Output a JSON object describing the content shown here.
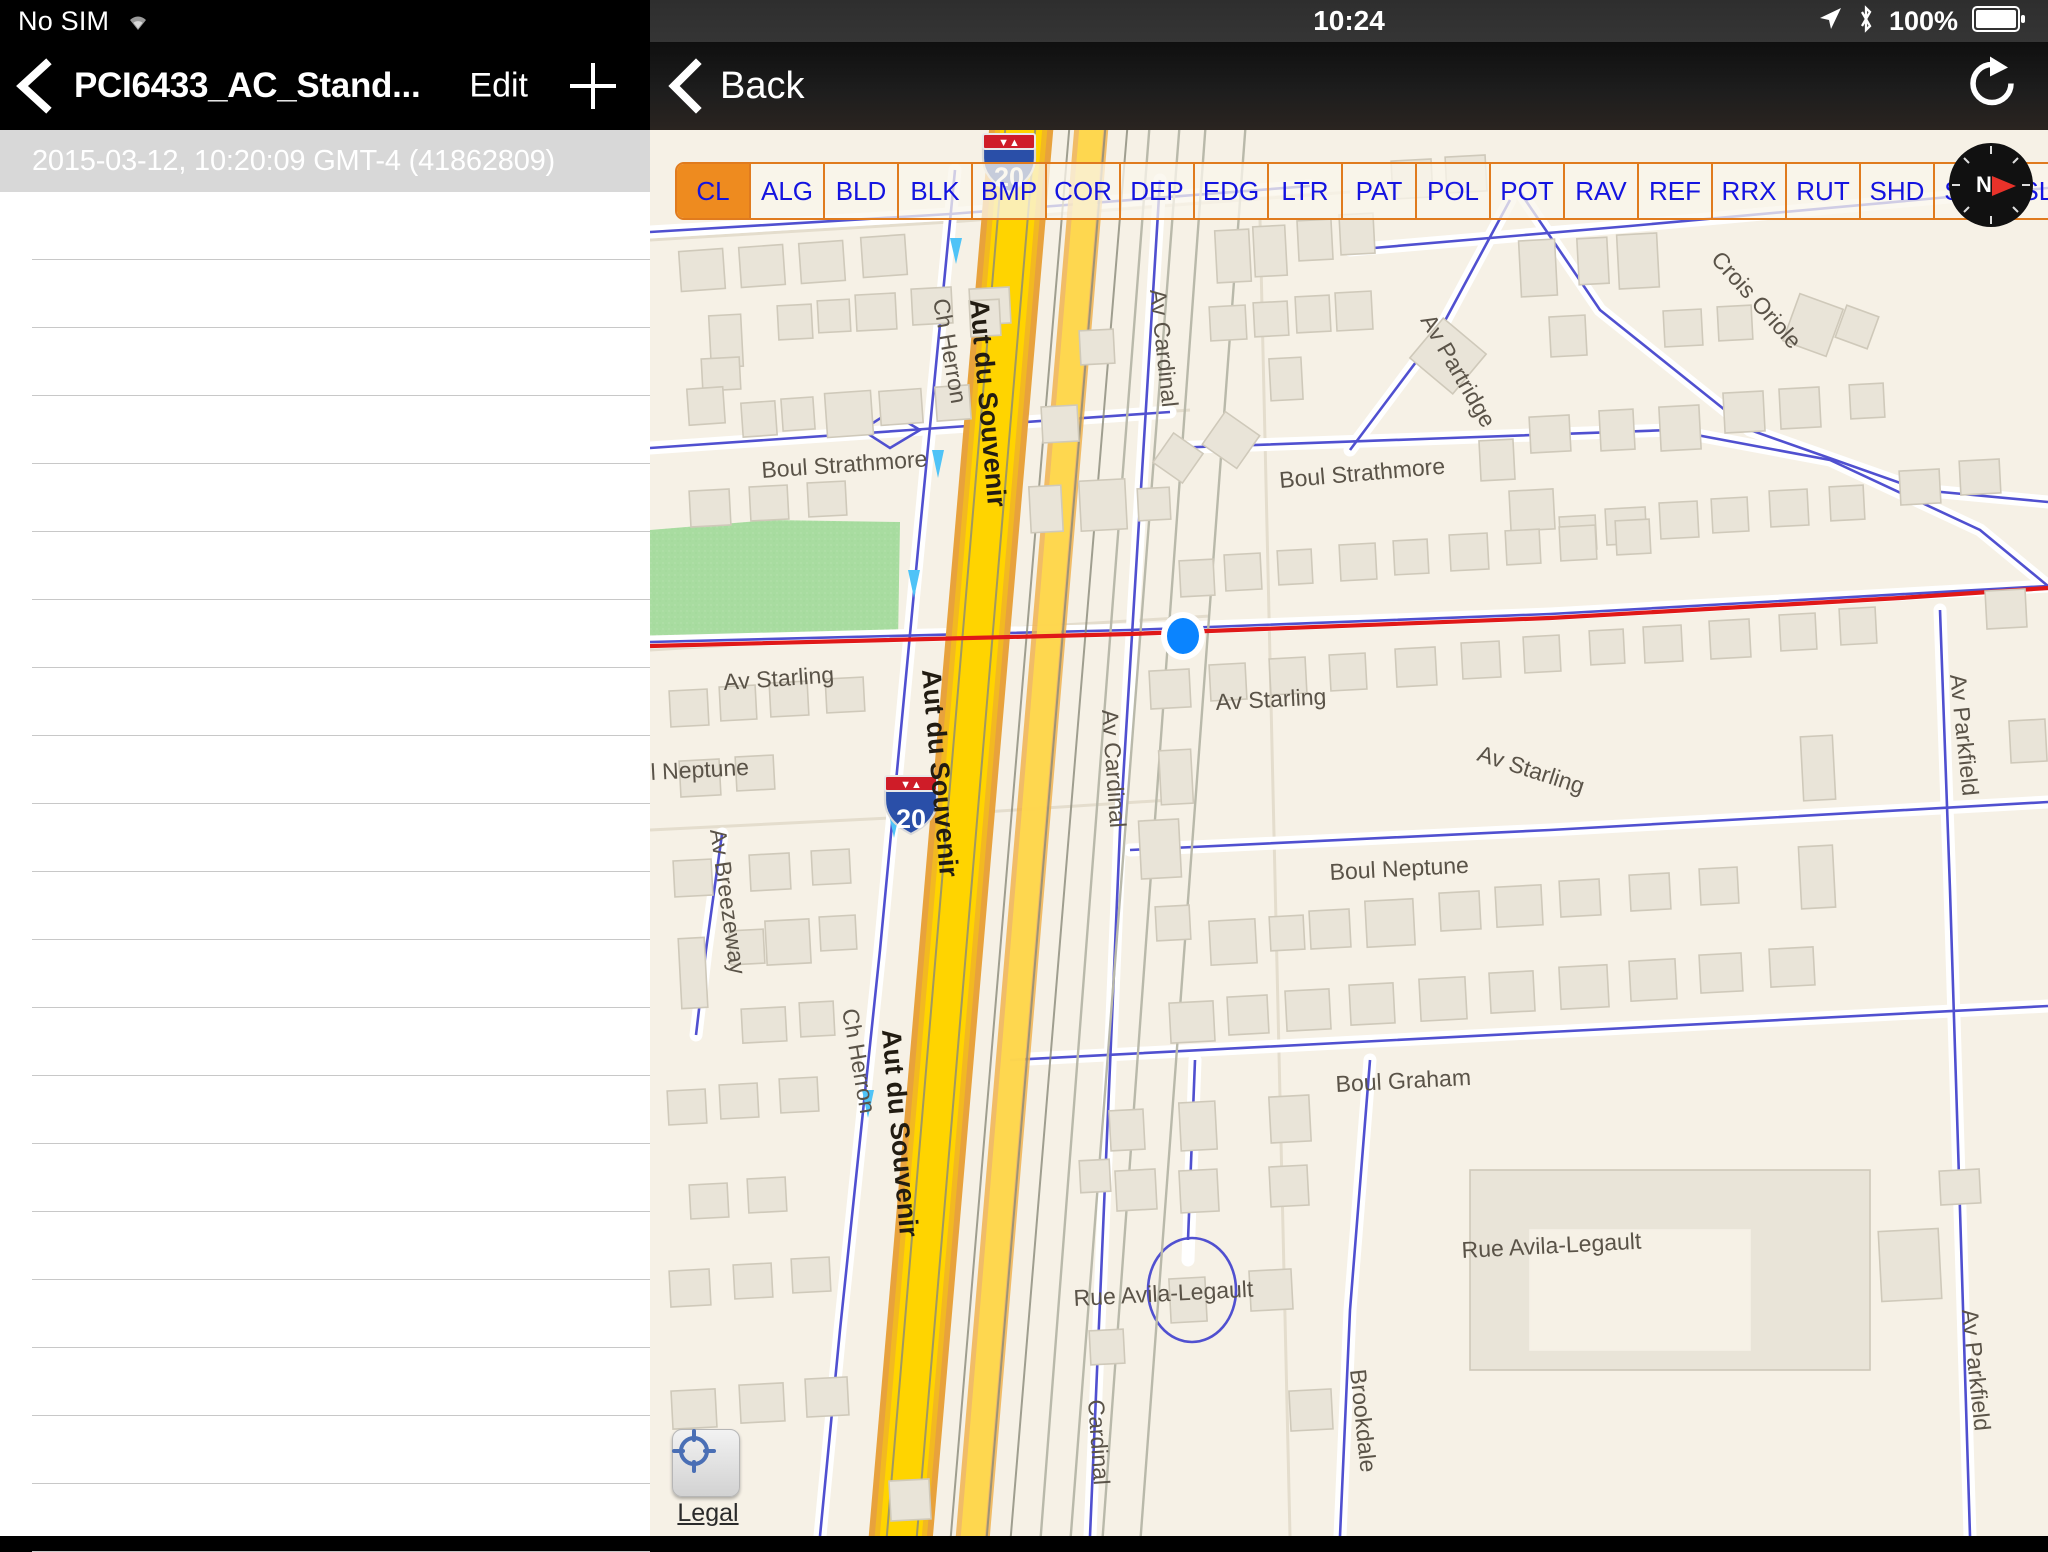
{
  "left_panel": {
    "status_bar": {
      "carrier": "No SIM",
      "wifi_icon": "wifi-icon"
    },
    "nav_bar": {
      "back_icon": "chevron-left-icon",
      "title": "PCI6433_AC_Stand...",
      "edit_label": "Edit",
      "add_icon": "plus-icon"
    },
    "list": {
      "selected_item": "2015-03-12, 10:20:09 GMT-4 (41862809)",
      "empty_row_count": 20
    }
  },
  "right_panel": {
    "status_bar": {
      "time": "10:24",
      "location_icon": "location-arrow-icon",
      "bluetooth_icon": "bluetooth-icon",
      "battery_percent": "100%",
      "battery_icon": "battery-full-icon"
    },
    "nav_bar": {
      "back_icon": "chevron-left-icon",
      "back_label": "Back",
      "refresh_icon": "refresh-icon"
    },
    "segmented_control": {
      "selected": "CL",
      "segments": [
        "CL",
        "ALG",
        "BLD",
        "BLK",
        "BMP",
        "COR",
        "DEP",
        "EDG",
        "LTR",
        "PAT",
        "POL",
        "POT",
        "RAV",
        "REF",
        "RRX",
        "RUT",
        "SHD",
        "SHV",
        "SLP"
      ]
    },
    "map": {
      "compass_icon": "compass-rose-icon",
      "compass_north_label": "N",
      "location_marker": "current-location-dot",
      "legal_button_icon": "crosshair-icon",
      "legal_label": "Legal",
      "highway_shields": [
        {
          "label": "20",
          "banner": "interstate-banner"
        },
        {
          "label": "20",
          "banner": "interstate-banner"
        }
      ],
      "street_labels": [
        "Boul Strathmore",
        "Boul Strathmore",
        "Ch Herron",
        "Aut du Souvenir",
        "Av Cardinal",
        "Av Partridge",
        "Crois Oriole",
        "Av Starling",
        "Av Starling",
        "Av Starling",
        "Boul Neptune",
        "Boul Neptune",
        "Av Parkfield",
        "Av Parkfield",
        "Boul Graham",
        "Av Breezeway",
        "Ch Herron",
        "Aut du Souvenir",
        "Aut du Souvenir",
        "Rue Avila-Legault",
        "Rue Avila-Legault",
        "Av Cardinal",
        "Brookdale"
      ]
    }
  },
  "colors": {
    "accent_orange": "#e07b1e",
    "segment_text_blue": "#1414e0",
    "map_background": "#f6f1e6",
    "highway_yellow": "#ffd400",
    "park_green": "#a8dca0",
    "road_casing_blue": "#5050d0",
    "selected_route_red": "#e01818",
    "location_dot_blue": "#0a84ff",
    "navbar_black": "#000000",
    "row_selected_gray": "#d8d8d8"
  }
}
